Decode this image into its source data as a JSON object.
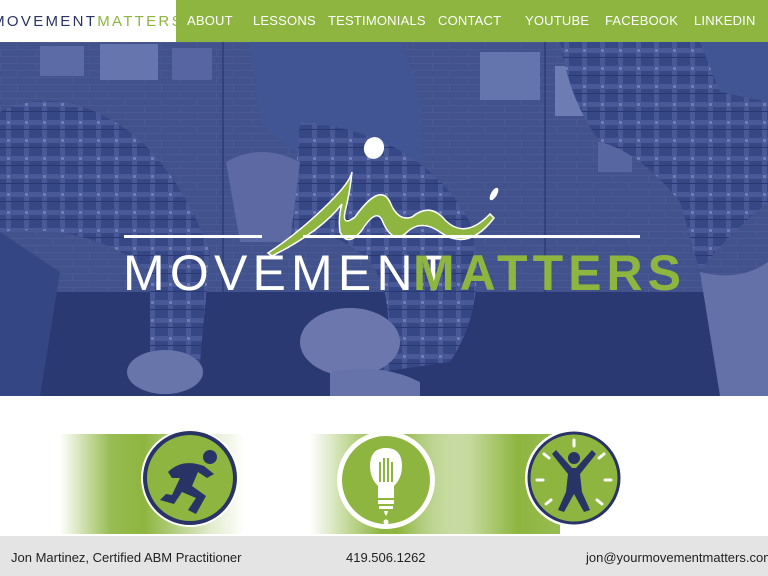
{
  "brand": {
    "word1": "MOVEMENT",
    "word2": "MATTERS"
  },
  "nav": [
    {
      "key": "about",
      "label": "ABOUT"
    },
    {
      "key": "lessons",
      "label": "LESSONS"
    },
    {
      "key": "testimonials",
      "label": "TESTIMONIALS"
    },
    {
      "key": "contact",
      "label": "CONTACT"
    },
    {
      "key": "youtube",
      "label": "YOUTUBE"
    },
    {
      "key": "facebook",
      "label": "FACEBOOK"
    },
    {
      "key": "linkedin",
      "label": "LINKEDIN"
    }
  ],
  "hero": {
    "logo_word1": "MOVEMENT",
    "logo_word2": "MATTERS"
  },
  "features": [
    {
      "icon": "running-figure-icon"
    },
    {
      "icon": "lightbulb-hand-icon"
    },
    {
      "icon": "star-jump-figure-icon"
    }
  ],
  "footer": {
    "name": "Jon Martinez, Certified ABM Practitioner",
    "phone": "419.506.1262",
    "email": "jon@yourmovementmatters.com"
  },
  "colors": {
    "green": "#8db53f",
    "navy": "#2a3366",
    "hero_overlay": "#2f3f78",
    "footer_bg": "#e4e4e4"
  }
}
